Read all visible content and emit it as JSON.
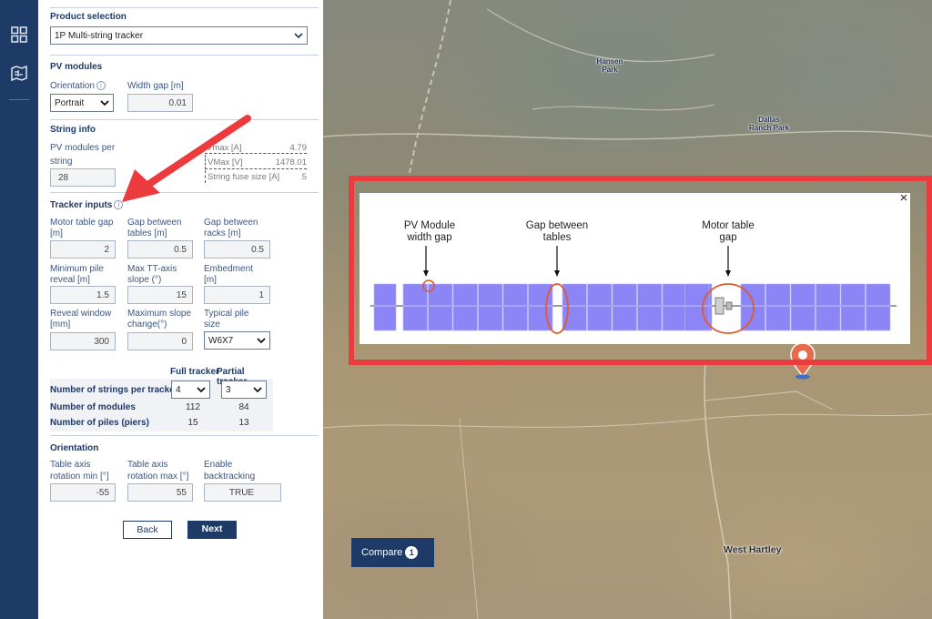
{
  "product": {
    "heading": "Product selection",
    "selected": "1P Multi-string tracker"
  },
  "pv": {
    "heading": "PV modules",
    "orientation_label": "Orientation",
    "orientation": "Portrait",
    "width_gap_label": "Width gap [m]",
    "width_gap": "0.01"
  },
  "string": {
    "heading": "String info",
    "modules_label_1": "PV modules per",
    "modules_label_2": "string",
    "modules": "28",
    "rows": [
      {
        "label": "Vmax [A]",
        "value": "4.79"
      },
      {
        "label": "VMax [V]",
        "value": "1478.01"
      },
      {
        "label": "String fuse size [A]",
        "value": "5"
      }
    ]
  },
  "tracker": {
    "heading": "Tracker inputs",
    "fields": [
      {
        "l1": "Motor table gap",
        "l2": "[m]",
        "value": "2"
      },
      {
        "l1": "Gap between",
        "l2": "tables [m]",
        "value": "0.5"
      },
      {
        "l1": "Gap between",
        "l2": "racks [m]",
        "value": "0.5"
      },
      {
        "l1": "Minimum pile",
        "l2": "reveal [m]",
        "value": "1.5"
      },
      {
        "l1": "Max TT-axis",
        "l2": "slope (°)",
        "value": "15"
      },
      {
        "l1": "Embedment",
        "l2": "[m]",
        "value": "1"
      },
      {
        "l1": "Reveal window",
        "l2": "[mm]",
        "value": "300"
      },
      {
        "l1": "Maximum slope",
        "l2": "change(°)",
        "value": "0"
      },
      {
        "l1": "Typical pile",
        "l2": "size",
        "value": "W6X7"
      }
    ]
  },
  "table": {
    "col_full": "Full tracker",
    "col_partial": "Partial tracker",
    "strings_label": "Number of strings per tracker",
    "strings_full": "4",
    "strings_partial": "3",
    "modules_label": "Number of modules",
    "modules_full": "112",
    "modules_partial": "84",
    "piles_label": "Number of piles (piers)",
    "piles_full": "15",
    "piles_partial": "13"
  },
  "orientation": {
    "heading": "Orientation",
    "fields": [
      {
        "l1": "Table axis",
        "l2": "rotation min [°]",
        "value": "-55"
      },
      {
        "l1": "Table axis",
        "l2": "rotation max [°]",
        "value": "55"
      },
      {
        "l1": "Enable",
        "l2": "backtracking",
        "value": "TRUE"
      }
    ]
  },
  "buttons": {
    "back": "Back",
    "next": "Next"
  },
  "map": {
    "compare_label": "Compare",
    "compare_count": "1",
    "places": [
      "Hansen Park",
      "Dallas Ranch Park",
      "West Hartley"
    ]
  },
  "diagram": {
    "labels": [
      {
        "l1": "PV Module",
        "l2": "width gap"
      },
      {
        "l1": "Gap between",
        "l2": "tables"
      },
      {
        "l1": "Motor table",
        "l2": "gap"
      }
    ],
    "close": "×"
  },
  "colors": {
    "navy": "#1e3a66",
    "callout": "#ec3b3e",
    "panel_module": "#8c85f6",
    "highlight": "#e05a2b"
  }
}
